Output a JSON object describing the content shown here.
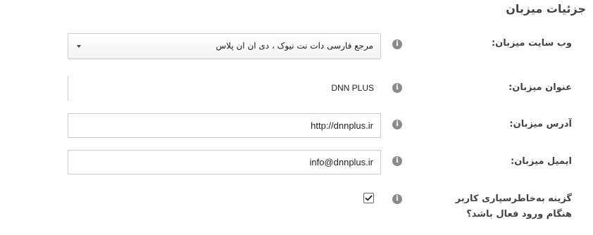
{
  "section": {
    "title": "جزئیات میزبان"
  },
  "fields": {
    "website": {
      "label": "وب سایت میزبان:",
      "value": "مرجع فارسی دات نت نیوک ، دی ان ان پلاس"
    },
    "name": {
      "label": "عنوان میزبان:",
      "value": "DNN PLUS"
    },
    "url": {
      "label": "آدرس میزبان:",
      "value": "http://dnnplus.ir"
    },
    "email": {
      "label": "ایمیل میزبان:",
      "value": "info@dnnplus.ir"
    },
    "remember_login": {
      "label": "گزینه به‌خاطرسپاری کاربر هنگام ورود فعال باشد؟",
      "checked": true
    }
  },
  "icons": {
    "info": "info-icon",
    "info_glyph": "i",
    "caret": "chevron-down-icon",
    "check": "checkmark-icon"
  }
}
